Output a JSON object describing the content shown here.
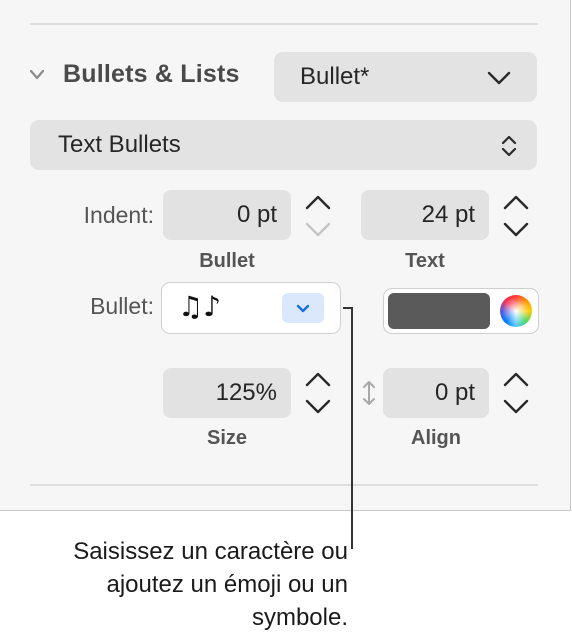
{
  "section": {
    "title": "Bullets & Lists",
    "style_popup_value": "Bullet*"
  },
  "bullet_type_popup": {
    "value": "Text Bullets"
  },
  "indent": {
    "label": "Indent:",
    "bullet_value": "0 pt",
    "bullet_caption": "Bullet",
    "text_value": "24 pt",
    "text_caption": "Text"
  },
  "bullet": {
    "label": "Bullet:",
    "character": "♫♪",
    "color_swatch": "#5a5a5a"
  },
  "size": {
    "value": "125%",
    "caption": "Size"
  },
  "align": {
    "value": "0 pt",
    "caption": "Align"
  },
  "callout": {
    "line1": "Saisissez un caractère ou",
    "line2": "ajoutez un émoji ou un",
    "line3": "symbole."
  }
}
